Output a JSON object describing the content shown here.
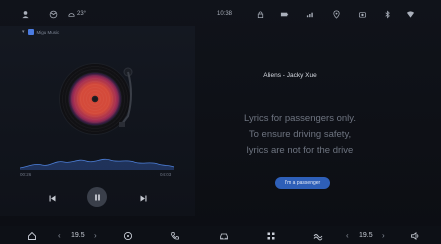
{
  "status_bar": {
    "temperature": "23°",
    "time": "10:38"
  },
  "player": {
    "source": "Migu Music",
    "source_expanded": "▾",
    "time_elapsed": "00:26",
    "time_total": "04:03"
  },
  "lyrics": {
    "song_title": "Aliens - Jacky Xue",
    "notice_line1": "Lyrics for passengers only.",
    "notice_line2": "To ensure driving safety,",
    "notice_line3": "lyrics are not for the drive",
    "passenger_button": "I'm a passenger"
  },
  "dock": {
    "left_temp": "19.5",
    "right_temp": "19.5"
  },
  "colors": {
    "accent": "#2e5fb8",
    "background": "#0c0e13"
  }
}
